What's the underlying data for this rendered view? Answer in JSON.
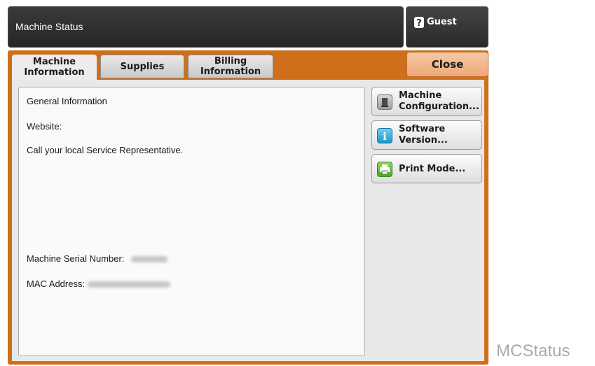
{
  "header": {
    "title": "Machine Status"
  },
  "user": {
    "label": "Guest",
    "icon": "user-question-icon"
  },
  "tabs": [
    {
      "label_line1": "Machine",
      "label_line2": "Information",
      "active": true
    },
    {
      "label_line1": "Supplies",
      "label_line2": "",
      "active": false
    },
    {
      "label_line1": "Billing",
      "label_line2": "Information",
      "active": false
    }
  ],
  "close_label": "Close",
  "info": {
    "general": "General Information",
    "website": "Website:",
    "service": "Call your local Service Representative.",
    "serial_label": "Machine Serial Number:",
    "mac_label": "MAC Address:"
  },
  "side_buttons": [
    {
      "line1": "Machine",
      "line2": "Configuration...",
      "icon": "machine-icon"
    },
    {
      "line1": "Software",
      "line2": "Version...",
      "icon": "info-icon"
    },
    {
      "line1": "Print Mode...",
      "line2": "",
      "icon": "printer-icon"
    }
  ],
  "watermark": "MCStatus",
  "colors": {
    "accent_orange": "#cf6f1a",
    "close_button": "#eea878",
    "header_dark": "#2f2f2f",
    "info_icon_blue": "#2aa7d8",
    "printer_icon_green": "#5cb23a"
  }
}
